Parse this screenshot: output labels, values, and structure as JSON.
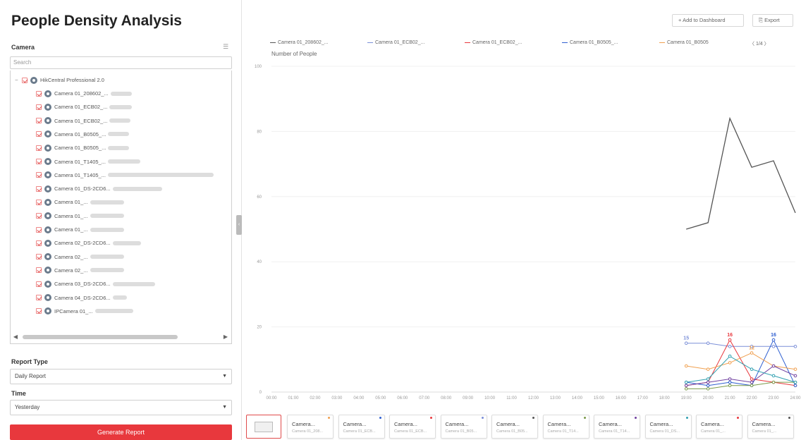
{
  "page": {
    "title": "People Density Analysis"
  },
  "sidebar": {
    "camera_label": "Camera",
    "search_placeholder": "Search",
    "tree_root": "HikCentral Professional 2.0",
    "cameras": [
      "Camera 01_208602_...",
      "Camera 01_ECB02_...",
      "Camera 01_ECB02_...",
      "Camera 01_B0505_...",
      "Camera 01_B0505_...",
      "Camera 01_T1405_...",
      "Camera 01_T1405_...",
      "Camera 01_DS-2CD6...",
      "Camera 01_...",
      "Camera 01_...",
      "Camera 01_...",
      "Camera 02_DS-2CD6...",
      "Camera 02_...",
      "Camera 02_...",
      "Camera 03_DS-2CD6...",
      "Camera 04_DS-2CD6...",
      "IPCamera 01_..."
    ],
    "report_type_label": "Report Type",
    "report_type_value": "Daily Report",
    "time_label": "Time",
    "time_value": "Yesterday",
    "generate_label": "Generate Report"
  },
  "toolbar": {
    "add_dashboard_label": "Add to Dashboard",
    "export_label": "Export"
  },
  "legend": {
    "items": [
      "Camera 01_208602_...",
      "Camera 01_ECB02_...",
      "Camera 01_ECB02_...",
      "Camera 01_B0505_...",
      "Camera 01_B0505"
    ],
    "page": "1/4"
  },
  "thumbnails": [
    {
      "title": "Camera...",
      "subtitle": "Camera 01_208..."
    },
    {
      "title": "Camera...",
      "subtitle": "Camera 01_ECB..."
    },
    {
      "title": "Camera...",
      "subtitle": "Camera 01_ECB..."
    },
    {
      "title": "Camera...",
      "subtitle": "Camera 01_B05..."
    },
    {
      "title": "Camera...",
      "subtitle": "Camera 01_B05..."
    },
    {
      "title": "Camera...",
      "subtitle": "Camera 01_T14..."
    },
    {
      "title": "Camera...",
      "subtitle": "Camera 01_T14..."
    },
    {
      "title": "Camera...",
      "subtitle": "Camera 01_DS..."
    },
    {
      "title": "Camera...",
      "subtitle": "Camera 01_..."
    },
    {
      "title": "Camera...",
      "subtitle": "Camera 01_..."
    }
  ],
  "colors": {
    "accent": "#e8383d",
    "series": [
      "#555555",
      "#7b8fd8",
      "#e8383d",
      "#2f5fd0",
      "#f0a050",
      "#7a9a4a",
      "#7040a0",
      "#30a0b0"
    ]
  },
  "chart_data": {
    "type": "line",
    "ylabel": "Number of People",
    "ylim": [
      0,
      100
    ],
    "yticks": [
      0,
      20,
      40,
      60,
      80,
      100
    ],
    "x": [
      "00:00",
      "01:00",
      "02:00",
      "03:00",
      "04:00",
      "05:00",
      "06:00",
      "07:00",
      "08:00",
      "09:00",
      "10:00",
      "11:00",
      "12:00",
      "13:00",
      "14:00",
      "15:00",
      "16:00",
      "17:00",
      "18:00",
      "19:00",
      "20:00",
      "21:00",
      "22:00",
      "23:00",
      "24:00"
    ],
    "series": [
      {
        "values": [
          null,
          null,
          null,
          null,
          null,
          null,
          null,
          null,
          null,
          null,
          null,
          null,
          null,
          null,
          null,
          null,
          null,
          null,
          null,
          50,
          52,
          84,
          69,
          71,
          55
        ]
      },
      {
        "values": [
          null,
          null,
          null,
          null,
          null,
          null,
          null,
          null,
          null,
          null,
          null,
          null,
          null,
          null,
          null,
          null,
          null,
          null,
          null,
          15,
          15,
          14,
          14,
          14,
          14
        ]
      },
      {
        "values": [
          null,
          null,
          null,
          null,
          null,
          null,
          null,
          null,
          null,
          null,
          null,
          null,
          null,
          null,
          null,
          null,
          null,
          null,
          null,
          2,
          3,
          16,
          4,
          3,
          2
        ]
      },
      {
        "values": [
          null,
          null,
          null,
          null,
          null,
          null,
          null,
          null,
          null,
          null,
          null,
          null,
          null,
          null,
          null,
          null,
          null,
          null,
          null,
          3,
          2,
          3,
          2,
          16,
          2
        ]
      },
      {
        "values": [
          null,
          null,
          null,
          null,
          null,
          null,
          null,
          null,
          null,
          null,
          null,
          null,
          null,
          null,
          null,
          null,
          null,
          null,
          null,
          8,
          7,
          9,
          12,
          8,
          7
        ]
      },
      {
        "values": [
          null,
          null,
          null,
          null,
          null,
          null,
          null,
          null,
          null,
          null,
          null,
          null,
          null,
          null,
          null,
          null,
          null,
          null,
          null,
          1,
          1,
          2,
          2,
          3,
          3
        ]
      },
      {
        "values": [
          null,
          null,
          null,
          null,
          null,
          null,
          null,
          null,
          null,
          null,
          null,
          null,
          null,
          null,
          null,
          null,
          null,
          null,
          null,
          2,
          3,
          4,
          3,
          8,
          5
        ]
      },
      {
        "values": [
          null,
          null,
          null,
          null,
          null,
          null,
          null,
          null,
          null,
          null,
          null,
          null,
          null,
          null,
          null,
          null,
          null,
          null,
          null,
          3,
          4,
          11,
          7,
          5,
          3
        ]
      }
    ],
    "point_labels": [
      {
        "series": 1,
        "index": 19,
        "text": "15"
      },
      {
        "series": 2,
        "index": 21,
        "text": "16"
      },
      {
        "series": 3,
        "index": 23,
        "text": "16"
      },
      {
        "series": 4,
        "index": 22,
        "text": "12"
      }
    ]
  }
}
